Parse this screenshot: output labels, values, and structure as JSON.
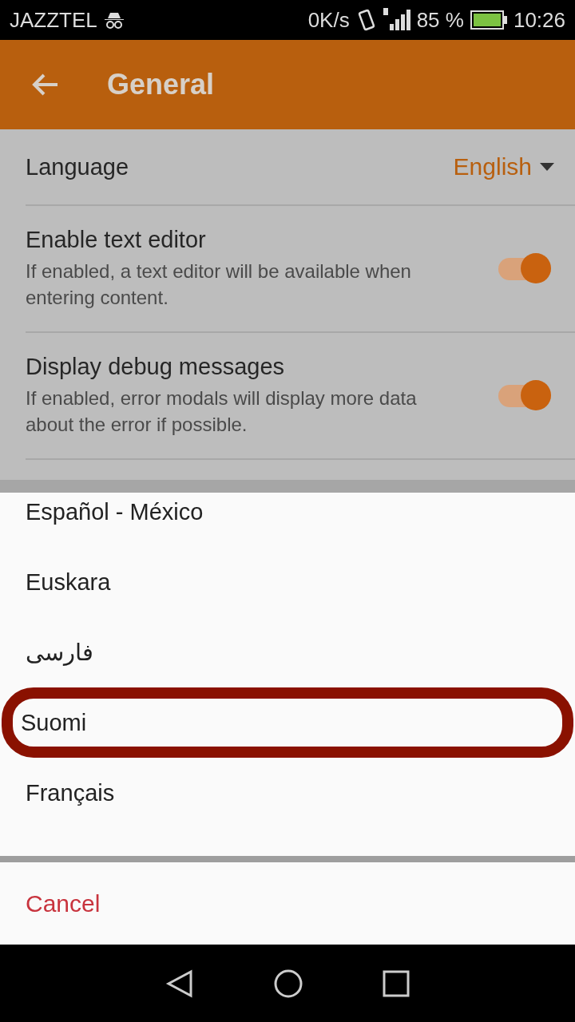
{
  "status_bar": {
    "carrier": "JAZZTEL",
    "speed": "0K/s",
    "battery": "85 %",
    "time": "10:26"
  },
  "app_bar": {
    "title": "General"
  },
  "settings": [
    {
      "kind": "dropdown",
      "label": "Language",
      "value": "English"
    },
    {
      "kind": "toggle",
      "label": "Enable text editor",
      "description": "If enabled, a text editor will be available when entering content.",
      "on": true
    },
    {
      "kind": "toggle",
      "label": "Display debug messages",
      "description": "If enabled, error modals will display more data about the error if possible.",
      "on": true
    }
  ],
  "language_sheet": {
    "options": [
      {
        "label": "Español - México",
        "highlighted": false
      },
      {
        "label": "Euskara",
        "highlighted": false
      },
      {
        "label": "فارسی",
        "highlighted": false
      },
      {
        "label": "Suomi",
        "highlighted": true
      },
      {
        "label": "Français",
        "highlighted": false
      }
    ],
    "cancel": "Cancel"
  }
}
